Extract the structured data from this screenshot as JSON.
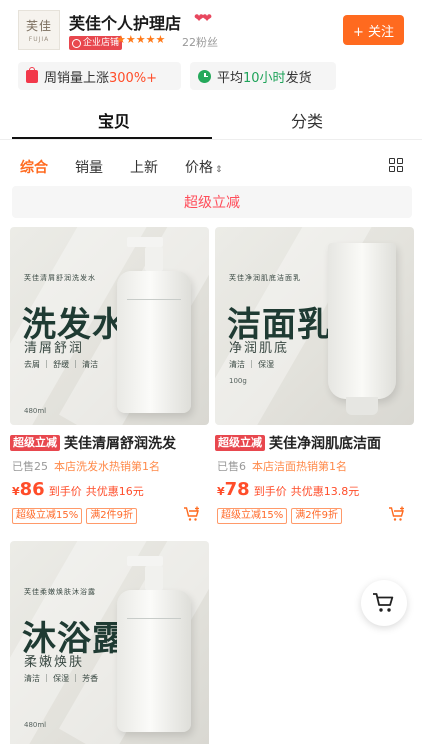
{
  "shop": {
    "logo_cn": "芙佳",
    "logo_en": "FUJIA",
    "name": "芙佳个人护理店",
    "hearts": "❤❤",
    "badge": "企业店铺",
    "stars": "★★★★★",
    "fans": "22粉丝",
    "follow_label": "+ 关注"
  },
  "stats": {
    "sales_prefix": "周销量上涨",
    "sales_value": "300%+",
    "ship_prefix": "平均",
    "ship_value": "10小时",
    "ship_suffix": "发货"
  },
  "tabs": [
    {
      "label": "宝贝"
    },
    {
      "label": "分类"
    }
  ],
  "sort": {
    "items": [
      "综合",
      "销量",
      "上新",
      "价格"
    ],
    "arrow": "⇕"
  },
  "promo_bar": "超级立减",
  "products": [
    {
      "img_small": "芙佳清屑舒润洗发水",
      "img_big": "洗发水",
      "img_sub": "清屑舒润",
      "img_tags": "去屑 ｜ 舒缓 ｜ 清洁",
      "img_vol": "480ml",
      "tag": "超级立减",
      "title": "芙佳清屑舒润洗发",
      "sold": "已售25",
      "rank": "本店洗发水热销第1名",
      "yen": "¥",
      "price": "86",
      "price_label": "到手价",
      "discount": "共优惠16元",
      "ptags": [
        "超级立减15%",
        "满2件9折"
      ]
    },
    {
      "img_small": "芙佳净润肌底洁面乳",
      "img_big": "洁面乳",
      "img_sub": "净润肌底",
      "img_tags": "清洁 ｜ 保湿",
      "img_vol": "100g",
      "tag": "超级立减",
      "title": "芙佳净润肌底洁面",
      "sold": "已售6",
      "rank": "本店洁面热销第1名",
      "yen": "¥",
      "price": "78",
      "price_label": "到手价",
      "discount": "共优惠13.8元",
      "ptags": [
        "超级立减15%",
        "满2件9折"
      ]
    },
    {
      "img_small": "芙佳柔嫩焕肤沐浴露",
      "img_big": "沐浴露",
      "img_sub": "柔嫩焕肤",
      "img_tags": "清洁 ｜ 保湿 ｜ 芳香",
      "img_vol": "480ml"
    }
  ],
  "colors": {
    "accent": "#ff6a1f",
    "price": "#ff4d2a",
    "promo_text": "#ff4d5a"
  }
}
